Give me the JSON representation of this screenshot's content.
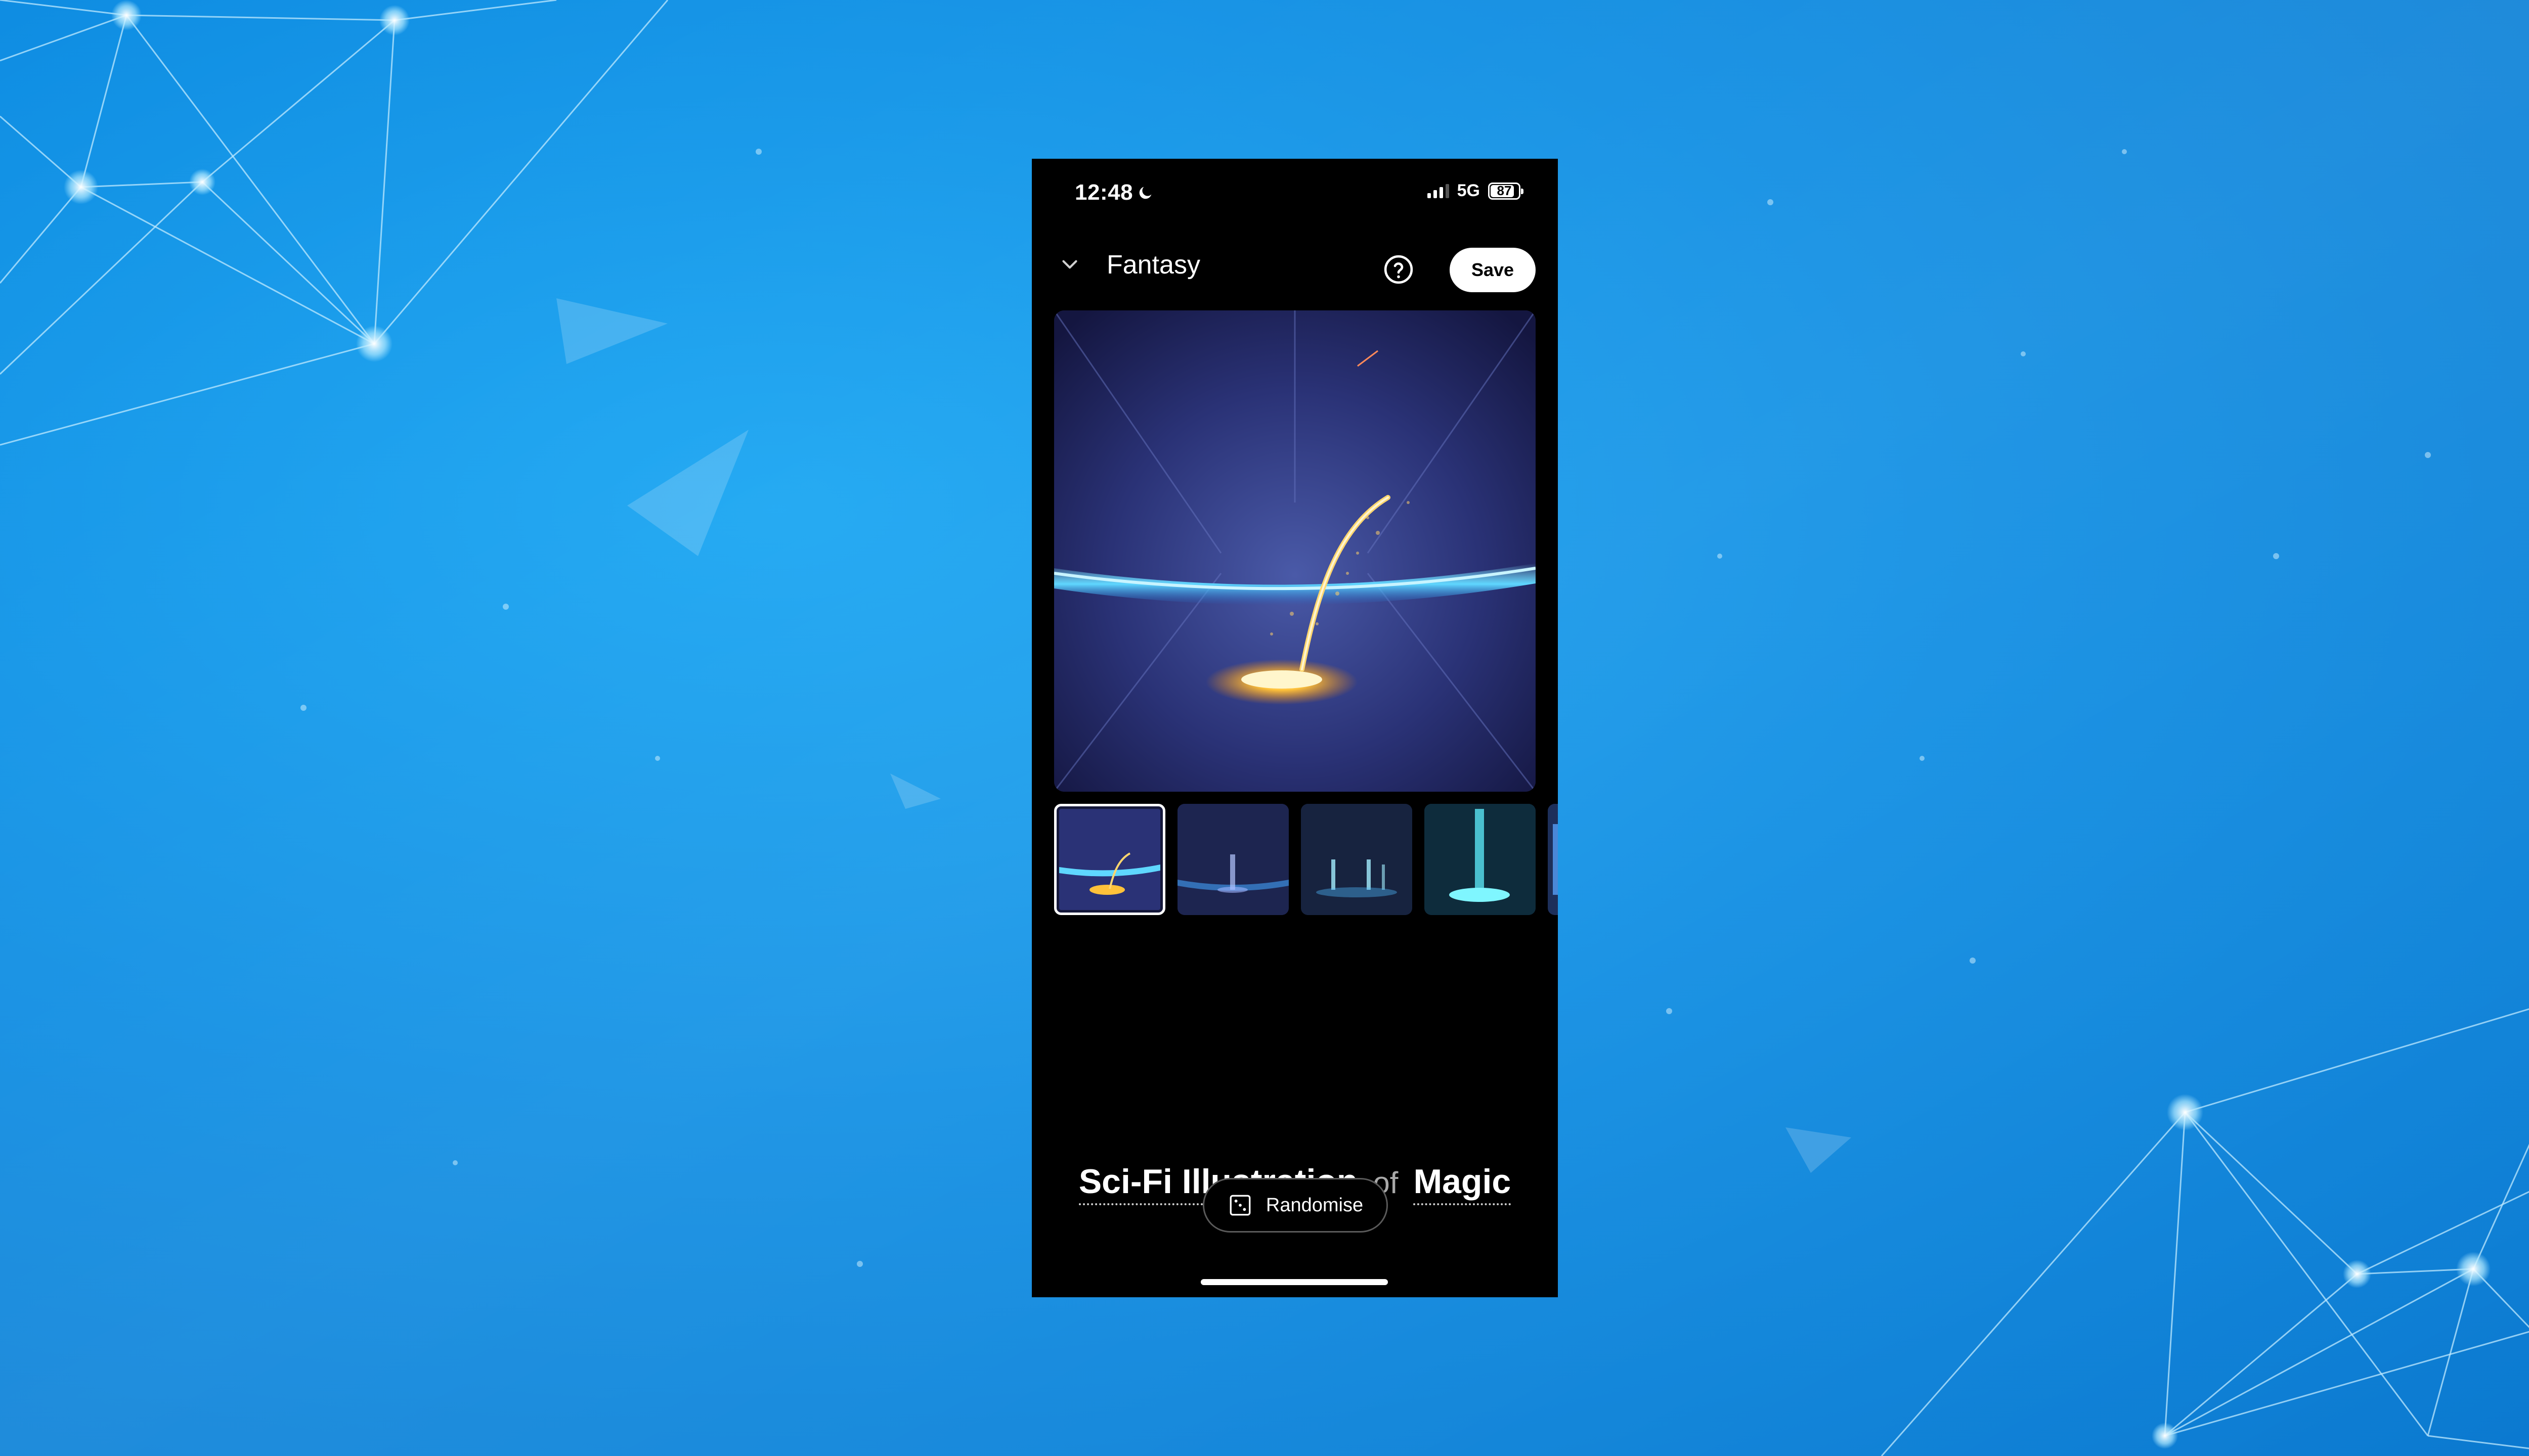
{
  "background": {
    "color": "#0f8ee3",
    "accent": "#7fd8ff"
  },
  "status_bar": {
    "time": "12:48",
    "dnd_icon": "moon-icon",
    "network": "5G",
    "battery": "87",
    "battery_level": 0.87
  },
  "header": {
    "back_icon": "chevron-down-icon",
    "title": "Fantasy",
    "help_icon": "question-circle-icon",
    "save_label": "Save"
  },
  "gallery": {
    "selected_index": 0,
    "thumbnail_count": 5
  },
  "prompt": {
    "style": "Sci-Fi Illustration",
    "connector": "of",
    "subject": "Magic"
  },
  "randomise": {
    "icon": "dice-icon",
    "label": "Randomise"
  }
}
